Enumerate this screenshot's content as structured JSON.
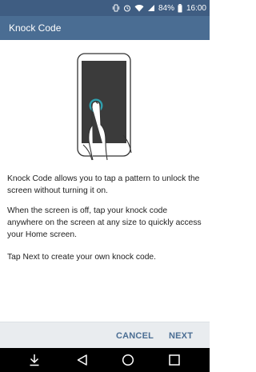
{
  "status_bar": {
    "battery_percent": "84%",
    "time": "16:00",
    "icons": [
      "vibrate-icon",
      "alarm-icon",
      "wifi-icon",
      "signal-icon",
      "battery-icon"
    ]
  },
  "app_bar": {
    "title": "Knock Code"
  },
  "main": {
    "illustration_icon": "phone-tap-illustration",
    "paragraphs": [
      "Knock Code allows you to tap a pattern to unlock the screen without turning it on.",
      "When the screen is off, tap your knock code anywhere on the screen at any size to quickly access your Home screen.",
      "Tap Next to create your own knock code."
    ]
  },
  "buttons": {
    "cancel_label": "CANCEL",
    "next_label": "NEXT"
  },
  "nav_bar": {
    "keys": [
      "notification-down-icon",
      "back-icon",
      "home-icon",
      "recent-apps-icon"
    ]
  },
  "colors": {
    "status_bar": "#3f5d82",
    "app_bar": "#4a6d93",
    "button_text": "#4a6d93",
    "button_bar": "#e9ecef",
    "illustration_ring": "#2f9fae"
  }
}
